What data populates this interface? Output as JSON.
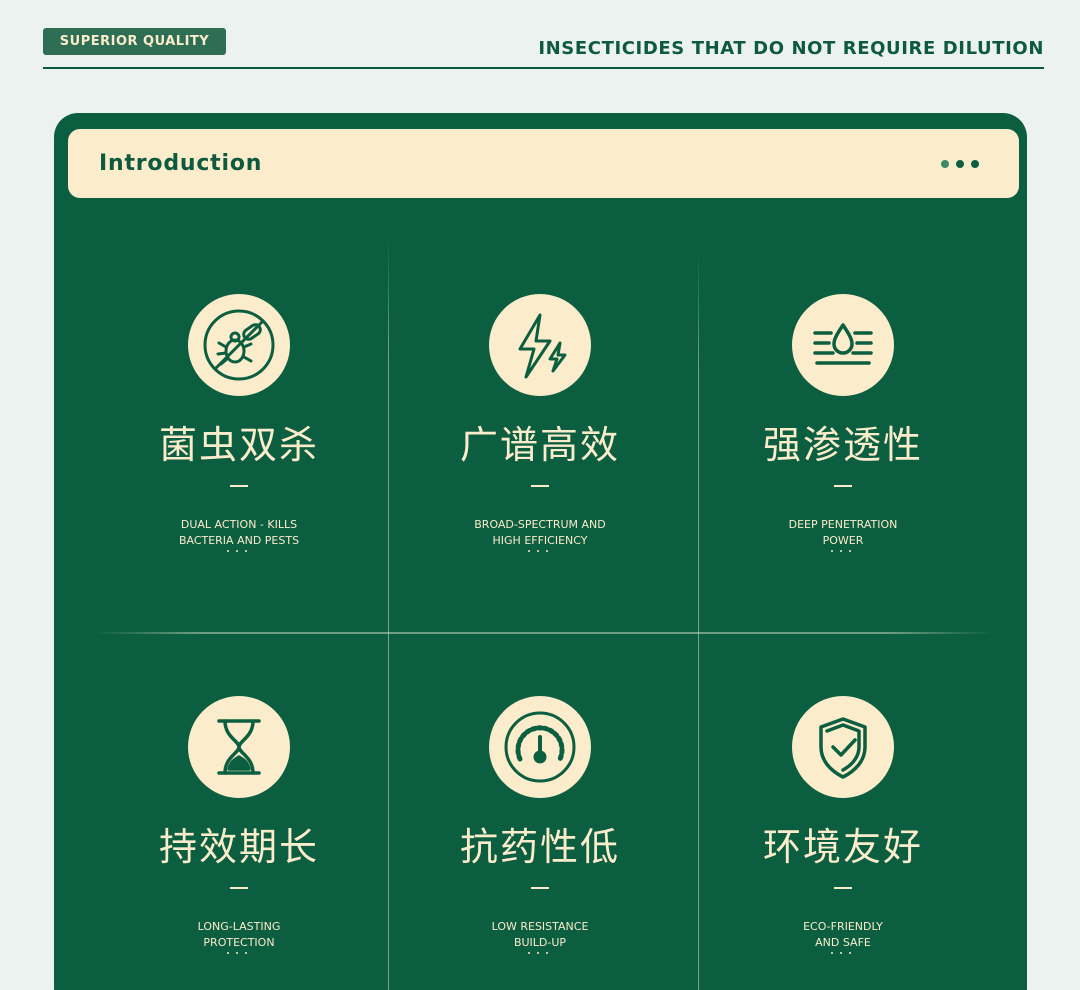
{
  "header": {
    "badge": "SUPERIOR QUALITY",
    "title": "INSECTICIDES THAT DO NOT REQUIRE DILUTION"
  },
  "intro": {
    "title": "Introduction"
  },
  "features": [
    {
      "icon": "no-bug-icon",
      "cn": "菌虫双杀",
      "en1": "DUAL ACTION - KILLS",
      "en2": "BACTERIA AND PESTS"
    },
    {
      "icon": "lightning-icon",
      "cn": "广谱高效",
      "en1": "BROAD-SPECTRUM AND",
      "en2": "HIGH EFFICIENCY"
    },
    {
      "icon": "penetration-drop-icon",
      "cn": "强渗透性",
      "en1": "DEEP PENETRATION",
      "en2": "POWER"
    },
    {
      "icon": "hourglass-icon",
      "cn": "持效期长",
      "en1": "LONG-LASTING",
      "en2": "PROTECTION"
    },
    {
      "icon": "gauge-icon",
      "cn": "抗药性低",
      "en1": "LOW RESISTANCE",
      "en2": "BUILD-UP"
    },
    {
      "icon": "shield-check-icon",
      "cn": "环境友好",
      "en1": "ECO-FRIENDLY",
      "en2": "AND SAFE"
    }
  ],
  "colors": {
    "primary_green": "#0b5e40",
    "cream": "#fbeccb",
    "background": "#ecf2f0"
  }
}
